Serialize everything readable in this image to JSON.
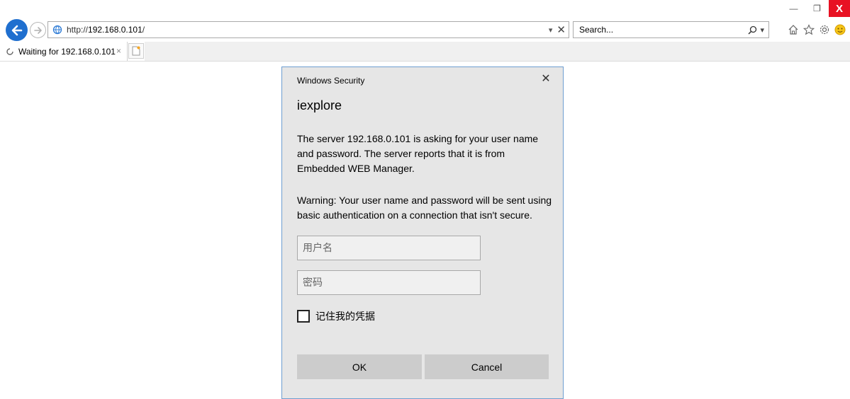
{
  "window": {
    "minimize_label": "—",
    "restore_label": "❐",
    "close_label": "X"
  },
  "address_bar": {
    "url_prefix": "http://",
    "url_host": "192.168.0.101",
    "url_suffix": "/",
    "dropdown_label": "▾",
    "stop_label": "✕"
  },
  "search": {
    "placeholder": "Search...",
    "dropdown_label": "▾"
  },
  "tab": {
    "title": "Waiting for 192.168.0.101",
    "close_label": "×"
  },
  "dialog": {
    "caption": "Windows Security",
    "close_label": "✕",
    "title": "iexplore",
    "message": "The server 192.168.0.101 is asking for your user name and password. The server reports that it is from Embedded WEB Manager.",
    "warning": "Warning: Your user name and password will be sent using basic authentication on a connection that isn't secure.",
    "username_placeholder": "用户名",
    "password_placeholder": "密码",
    "remember_label": "记住我的凭据",
    "ok_label": "OK",
    "cancel_label": "Cancel"
  },
  "icons": {
    "back": "back-arrow-icon",
    "forward": "forward-arrow-icon",
    "site": "site-globe-icon",
    "search": "magnifier-icon",
    "home": "home-icon",
    "favorites": "star-icon",
    "settings": "gear-icon",
    "feedback": "smiley-icon",
    "loading": "loading-spinner-icon",
    "new_tab": "new-tab-icon"
  },
  "colors": {
    "back_button": "#1f6fcf",
    "close_button": "#e81123",
    "dialog_background": "#e6e6e6",
    "dialog_border": "#6e9ed1",
    "button_background": "#cccccc",
    "field_background": "#f0f0f0"
  }
}
